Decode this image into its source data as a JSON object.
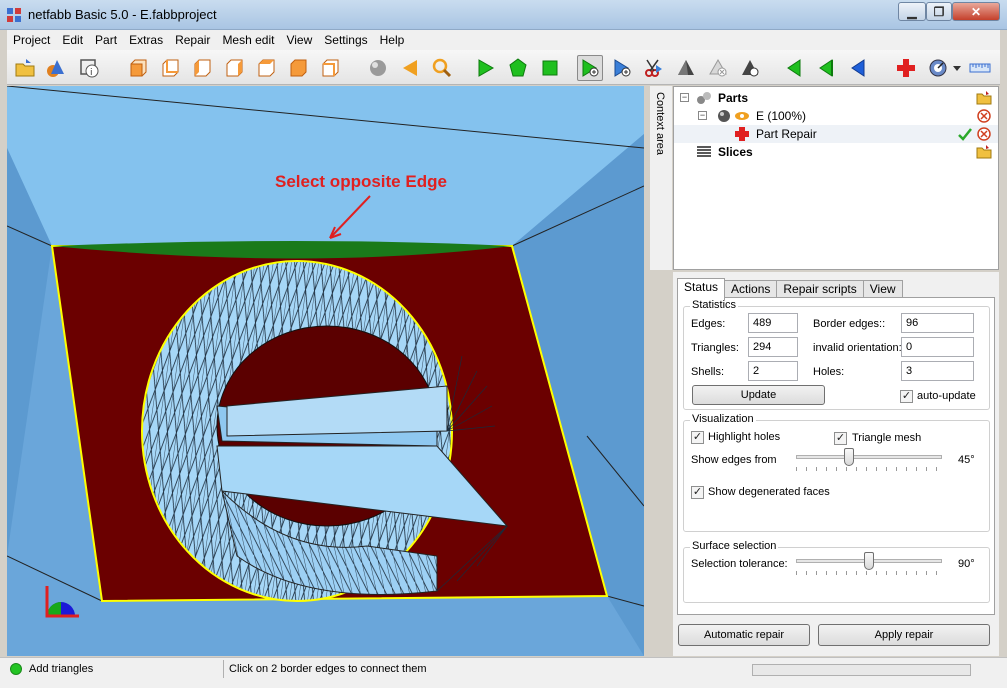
{
  "window": {
    "title": "netfabb Basic 5.0 - E.fabbproject",
    "min_label": "▁",
    "max_label": "❐",
    "close_label": "✕"
  },
  "menu": [
    "Project",
    "Edit",
    "Part",
    "Extras",
    "Repair",
    "Mesh edit",
    "View",
    "Settings",
    "Help"
  ],
  "toolbar": {
    "icons": [
      "open-project-icon",
      "add-part-icon",
      "part-info-icon",
      "view-front-icon",
      "view-back-icon",
      "view-left-icon",
      "view-right-icon",
      "view-top-icon",
      "view-bottom-icon",
      "view-3d-icon",
      "shaded-view-icon",
      "select-triangles-icon",
      "zoom-icon",
      "select-triangle-icon",
      "select-shell-icon",
      "select-surface-icon",
      "add-triangles-icon",
      "add-triangle-blue-icon",
      "cut-icon",
      "pyramid-icon",
      "remove-triangle-icon",
      "stitch-icon",
      "flip-icon",
      "invert-icon",
      "blue-flip-icon",
      "repair-cross-icon",
      "gauge-icon",
      "measure-ruler-icon"
    ]
  },
  "viewport": {
    "annotation": "Select opposite Edge"
  },
  "context_area": {
    "label": "Context area"
  },
  "tree": {
    "parts_label": "Parts",
    "part_label": "E (100%)",
    "repair_label": "Part Repair",
    "slices_label": "Slices"
  },
  "tabs": [
    "Status",
    "Actions",
    "Repair scripts",
    "View"
  ],
  "statistics": {
    "title": "Statistics",
    "edges_label": "Edges:",
    "edges_value": "489",
    "triangles_label": "Triangles:",
    "triangles_value": "294",
    "shells_label": "Shells:",
    "shells_value": "2",
    "border_edges_label": "Border edges::",
    "border_edges_value": "96",
    "invalid_orientation_label": "invalid orientation:",
    "invalid_orientation_value": "0",
    "holes_label": "Holes:",
    "holes_value": "3",
    "update_button": "Update",
    "auto_update_label": "auto-update"
  },
  "visualization": {
    "title": "Visualization",
    "highlight_holes_label": "Highlight holes",
    "triangle_mesh_label": "Triangle mesh",
    "show_edges_label": "Show edges from",
    "show_edges_value": "45°",
    "show_edges_level": 0.35,
    "degenerated_faces_label": "Show degenerated faces"
  },
  "surface_selection": {
    "title": "Surface selection",
    "tolerance_label": "Selection tolerance:",
    "tolerance_value": "90°",
    "tolerance_level": 0.5
  },
  "buttons": {
    "automatic_repair": "Automatic repair",
    "apply_repair": "Apply repair"
  },
  "statusbar": {
    "mode": "Add triangles",
    "hint": "Click on 2 border edges to connect them"
  },
  "colors": {
    "viewport_bg": "#5fa0d6",
    "plate": "#6b0000",
    "mesh": "#9fd3f7",
    "border_highlight": "#ffff00",
    "selected_edge": "#1a7a1a",
    "annotation": "#e02020"
  }
}
